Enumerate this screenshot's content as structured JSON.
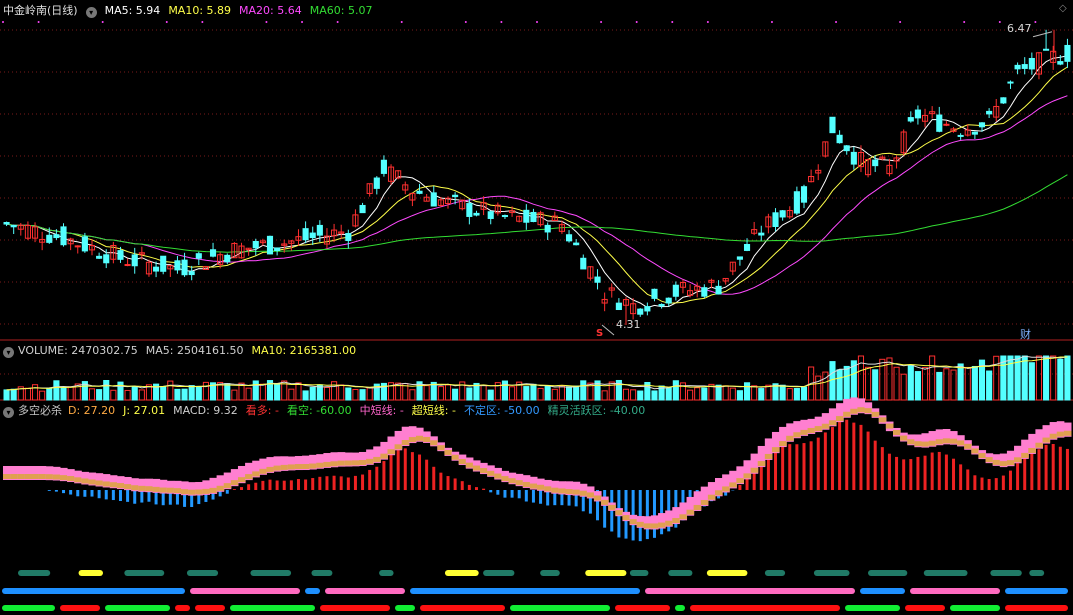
{
  "stock_title": "中金岭南(日线)",
  "ma_legend": [
    {
      "label": "MA5: 5.94",
      "color": "#ffffff"
    },
    {
      "label": "MA10: 5.89",
      "color": "#ffff4a"
    },
    {
      "label": "MA20: 5.64",
      "color": "#ff4aff"
    },
    {
      "label": "MA60: 5.07",
      "color": "#33dd33"
    }
  ],
  "volume_legend": [
    {
      "label": "VOLUME: 2470302.75",
      "color": "#d0d0d0"
    },
    {
      "label": "MA5: 2504161.50",
      "color": "#d0d0d0"
    },
    {
      "label": "MA10: 2165381.00",
      "color": "#ffff4a"
    }
  ],
  "indicator_title": "多空必杀",
  "indicator_legend": [
    {
      "label": "D: 27.20",
      "color": "#ffaa44"
    },
    {
      "label": "J: 27.01",
      "color": "#ffff4a"
    },
    {
      "label": "MACD: 9.32",
      "color": "#d0d0d0"
    },
    {
      "label": "看多: -",
      "color": "#ff3333"
    },
    {
      "label": "看空: -60.00",
      "color": "#33dd33"
    },
    {
      "label": "中短线: -",
      "color": "#ff66cc"
    },
    {
      "label": "超短线: -",
      "color": "#ffff4a"
    },
    {
      "label": "不定区: -50.00",
      "color": "#3399ff"
    },
    {
      "label": "精灵活跃区: -40.00",
      "color": "#33aa88"
    }
  ],
  "annotations": {
    "high": "6.47",
    "low": "4.31",
    "badge_s": "S",
    "badge_cai": "财"
  },
  "colors": {
    "up": "#ff3030",
    "down": "#54ffff",
    "bg": "#000000",
    "grid": "#7a1a1a"
  },
  "chart_data": [
    {
      "type": "candlestick",
      "title": "中金岭南(日线)",
      "ylim": [
        4.2,
        6.6
      ],
      "high": 6.47,
      "low": 4.31,
      "series": [
        {
          "name": "MA5",
          "values": [
            5.94
          ]
        },
        {
          "name": "MA10",
          "values": [
            5.89
          ]
        },
        {
          "name": "MA20",
          "values": [
            5.64
          ]
        },
        {
          "name": "MA60",
          "values": [
            5.07
          ]
        }
      ]
    },
    {
      "type": "bar",
      "title": "VOLUME",
      "values": [
        2470302.75
      ],
      "series": [
        {
          "name": "MA5",
          "values": [
            2504161.5
          ]
        },
        {
          "name": "MA10",
          "values": [
            2165381.0
          ]
        }
      ]
    },
    {
      "type": "area",
      "title": "多空必杀",
      "series": [
        {
          "name": "D",
          "values": [
            27.2
          ]
        },
        {
          "name": "J",
          "values": [
            27.01
          ]
        },
        {
          "name": "MACD",
          "values": [
            9.32
          ]
        }
      ]
    }
  ]
}
